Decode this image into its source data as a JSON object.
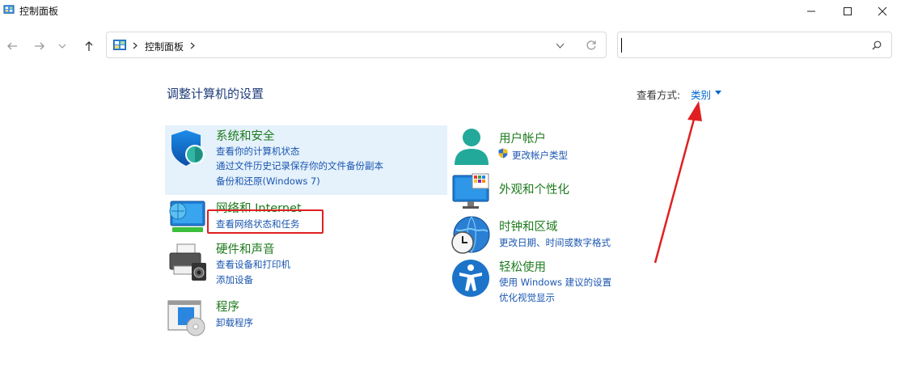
{
  "window": {
    "title": "控制面板"
  },
  "address_bar": {
    "breadcrumb": [
      "控制面板"
    ],
    "search_value": ""
  },
  "main": {
    "heading": "调整计算机的设置",
    "view_by_label": "查看方式:",
    "view_by_value": "类别"
  },
  "categories": [
    {
      "title": "系统和安全",
      "links": [
        "查看你的计算机状态",
        "通过文件历史记录保存你的文件备份副本",
        "备份和还原(Windows 7)"
      ],
      "icon": "shield-icon"
    },
    {
      "title": "网络和 Internet",
      "links": [
        "查看网络状态和任务"
      ],
      "icon": "network-globe-icon"
    },
    {
      "title": "硬件和声音",
      "links": [
        "查看设备和打印机",
        "添加设备"
      ],
      "icon": "printer-icon"
    },
    {
      "title": "程序",
      "links": [
        "卸载程序"
      ],
      "icon": "programs-icon"
    },
    {
      "title": "用户帐户",
      "links": [
        "更改帐户类型"
      ],
      "icon": "user-icon"
    },
    {
      "title": "外观和个性化",
      "links": [],
      "icon": "monitor-icon"
    },
    {
      "title": "时钟和区域",
      "links": [
        "更改日期、时间或数字格式"
      ],
      "icon": "clock-globe-icon"
    },
    {
      "title": "轻松使用",
      "links": [
        "使用 Windows 建议的设置",
        "优化视觉显示"
      ],
      "icon": "accessibility-icon"
    }
  ],
  "colors": {
    "category_title": "#1e7b1e",
    "link": "#1a56b0",
    "highlight": "#e5f1fb",
    "annotation": "#e02020"
  }
}
